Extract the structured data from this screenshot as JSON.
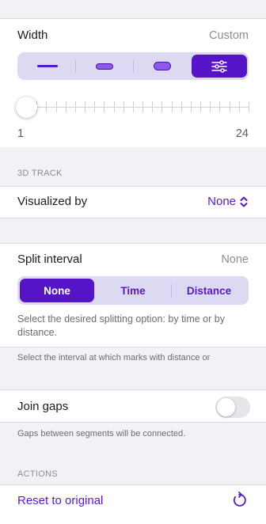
{
  "width_row": {
    "label": "Width",
    "value": "Custom"
  },
  "width_options": [
    {
      "name": "thin",
      "icon": "thin-line-icon",
      "selected": false
    },
    {
      "name": "medium",
      "icon": "medium-line-icon",
      "selected": false
    },
    {
      "name": "bold",
      "icon": "bold-line-icon",
      "selected": false
    },
    {
      "name": "custom",
      "icon": "sliders-icon",
      "selected": true
    }
  ],
  "width_slider": {
    "min_label": "1",
    "max_label": "24",
    "value": 1
  },
  "track_section": {
    "header": "3D TRACK",
    "label": "Visualized by",
    "value": "None",
    "icon": "chevron-up-down-icon"
  },
  "split_section": {
    "label": "Split interval",
    "value": "None",
    "options": [
      "None",
      "Time",
      "Distance"
    ],
    "selected": "None",
    "description": "Select the desired splitting option: by time or by distance.",
    "footer": "Select the interval at which marks with distance or"
  },
  "join_gaps": {
    "label": "Join gaps",
    "enabled": false,
    "footer": "Gaps between segments will be connected."
  },
  "actions": {
    "header": "ACTIONS",
    "reset_label": "Reset to original",
    "icon": "reset-icon"
  },
  "colors": {
    "accent": "#5514c7",
    "accent_text": "#5a19cf",
    "segment_bg": "#dcd9f2",
    "background": "#f2f2f6",
    "slider_fill": "#2f7cf6"
  }
}
